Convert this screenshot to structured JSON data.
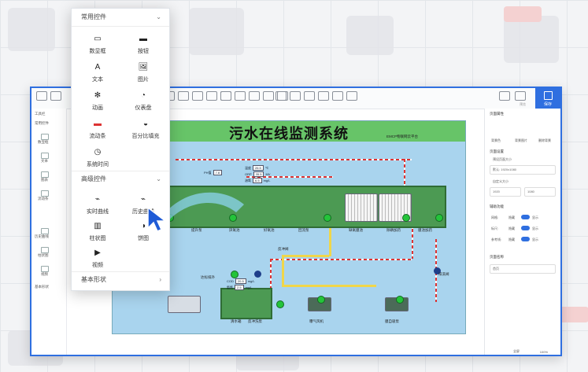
{
  "window": {
    "toolbar": {
      "save_label": "保存",
      "view_label": "预览"
    },
    "left_rail": {
      "items": [
        "工具栏",
        "常用控件",
        "数显框",
        "文本",
        "图表",
        "流动条",
        "历史曲线",
        "柱状图",
        "视频",
        "基本形状"
      ]
    },
    "canvas": {
      "title": "污水在线监测系统",
      "subtitle": "EMCP物联网云平台",
      "labels": [
        "污水调节池",
        "提升泵",
        "厌氧池",
        "好氧池",
        "回流泵",
        "缺氧膜池",
        "除磷加药",
        "膜池加药",
        "反冲洗泵",
        "曝气风机",
        "膜自吸泵",
        "清水箱",
        "达标排外",
        "反冲阀",
        "排洗阀"
      ],
      "readouts": [
        {
          "label": "温度",
          "value": "26.5",
          "unit": "℃"
        },
        {
          "label": "ORP",
          "value": "35.5",
          "unit": "MV"
        },
        {
          "label": "溶氧",
          "value": "6.5",
          "unit": "mg/L"
        },
        {
          "label": "COD",
          "value": "20.5",
          "unit": "mg/L"
        },
        {
          "label": "氨氮",
          "value": "2.5",
          "unit": "mg/L"
        },
        {
          "label": "PH值",
          "value": "7.8",
          "unit": ""
        }
      ]
    },
    "right_panel": {
      "header": "页面属性",
      "btns": [
        "背景色",
        "背景图片",
        "删除背景"
      ],
      "size_section": "页面设置",
      "fixed_size_label": "预设页面大小",
      "size_option": "默认: 1920x1080",
      "custom_label": "自定义大小",
      "width_value": "1920",
      "height_value": "1080",
      "assist_section": "辅助功能",
      "assist_items": [
        {
          "label": "网格:",
          "off": "隐藏",
          "on": "显示"
        },
        {
          "label": "标尺:",
          "off": "隐藏",
          "on": "显示"
        },
        {
          "label": "参考线:",
          "off": "隐藏",
          "on": "显示"
        }
      ],
      "page_name_section": "页面名称",
      "page_name_value": "首页"
    },
    "footer": {
      "zoom": "100%",
      "fit_label": "全屏"
    }
  },
  "panel": {
    "common_header": "常用控件",
    "common_items": [
      {
        "label": "数显框",
        "icon": "display-box-icon",
        "glyph": "▭"
      },
      {
        "label": "按钮",
        "icon": "button-icon",
        "glyph": "▬"
      },
      {
        "label": "文本",
        "icon": "text-icon",
        "glyph": "A"
      },
      {
        "label": "图片",
        "icon": "image-icon",
        "glyph": "🖼"
      },
      {
        "label": "动画",
        "icon": "animation-icon",
        "glyph": "✻"
      },
      {
        "label": "仪表盘",
        "icon": "gauge-icon",
        "glyph": "◔"
      },
      {
        "label": "流动条",
        "icon": "flow-bar-icon",
        "glyph": "▬"
      },
      {
        "label": "百分比填充",
        "icon": "percent-fill-icon",
        "glyph": "◒"
      },
      {
        "label": "系统时间",
        "icon": "clock-icon",
        "glyph": "◷"
      }
    ],
    "advanced_header": "高级控件",
    "advanced_items": [
      {
        "label": "实时曲线",
        "icon": "realtime-curve-icon",
        "glyph": "⌁"
      },
      {
        "label": "历史曲线",
        "icon": "history-curve-icon",
        "glyph": "⌁"
      },
      {
        "label": "柱状图",
        "icon": "bar-chart-icon",
        "glyph": "▥"
      },
      {
        "label": "饼图",
        "icon": "pie-chart-icon",
        "glyph": "◑"
      },
      {
        "label": "视频",
        "icon": "video-icon",
        "glyph": "▶"
      }
    ],
    "basic_header": "基本形状"
  }
}
